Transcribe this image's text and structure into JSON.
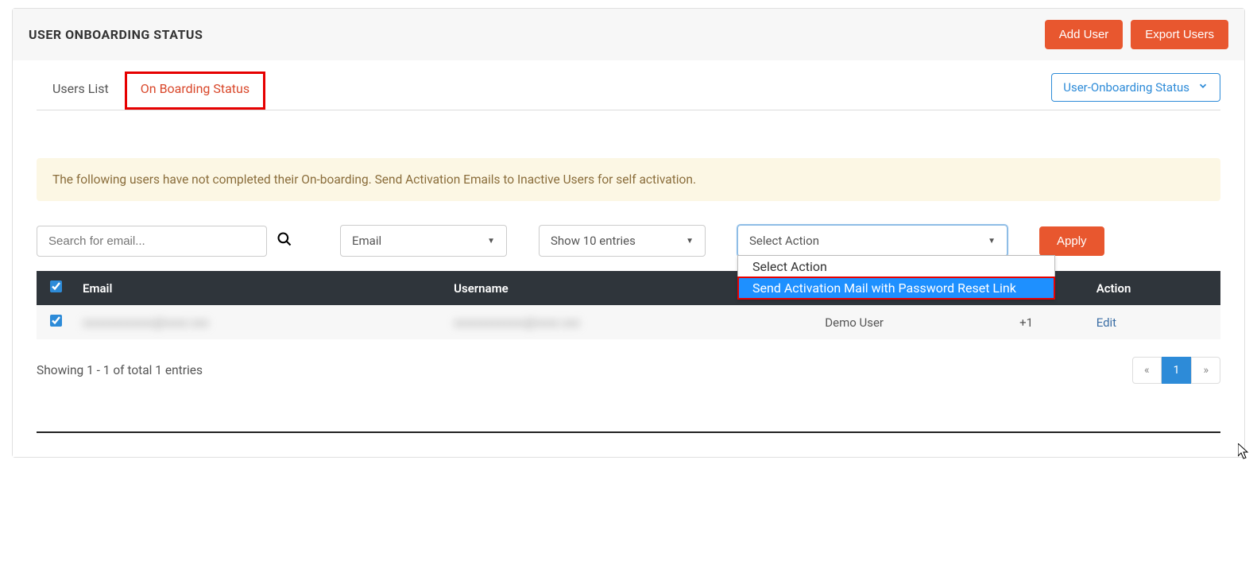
{
  "header": {
    "title": "USER ONBOARDING STATUS",
    "add_user": "Add User",
    "export_users": "Export Users"
  },
  "tabs": {
    "users_list": "Users List",
    "onboarding_status": "On Boarding Status"
  },
  "status_dropdown": {
    "label": "User-Onboarding Status"
  },
  "banner": {
    "text": "The following users have not completed their On-boarding. Send Activation Emails to Inactive Users for self activation."
  },
  "controls": {
    "search_placeholder": "Search for email...",
    "filter_field": "Email",
    "entries": "Show 10 entries",
    "action_selected": "Select Action",
    "action_options": {
      "opt0": "Select Action",
      "opt1": "Send Activation Mail with Password Reset Link"
    },
    "apply": "Apply"
  },
  "table": {
    "cols": {
      "email": "Email",
      "username": "Username",
      "name": "",
      "phone": "",
      "action": "Action"
    },
    "row0": {
      "email": "xxxxxxxxxxxx@xxxx.xxx",
      "username": "xxxxxxxxxxxx@xxxx.xxx",
      "name": "Demo User",
      "phone": "+1",
      "action": "Edit"
    }
  },
  "footer": {
    "summary": "Showing 1 - 1 of total 1 entries",
    "page": "1"
  }
}
